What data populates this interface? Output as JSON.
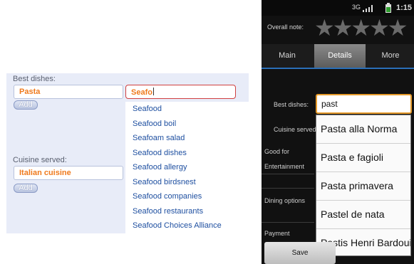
{
  "web": {
    "best_dishes_label": "Best dishes:",
    "best_dish_value": "Pasta",
    "search_value": "Seafo",
    "add_label": "Add",
    "cuisine_label": "Cuisine served:",
    "cuisine_value": "Italian cuisine",
    "suggestions": [
      "Seafood",
      "Seafood boil",
      "Seafoam salad",
      "Seafood dishes",
      "Seafood allergy",
      "Seafood birdsnest",
      "Seafood companies",
      "Seafood restaurants",
      "Seafood Choices Alliance"
    ]
  },
  "android": {
    "status": {
      "network": "3G",
      "time": "1:15"
    },
    "overall_note_label": "Overall note:",
    "rating": 0,
    "tabs": [
      {
        "label": "Main",
        "selected": false
      },
      {
        "label": "Details",
        "selected": true
      },
      {
        "label": "More",
        "selected": false
      }
    ],
    "rows": {
      "best_dishes": "Best dishes:",
      "cuisine_served": "Cuisine served",
      "good_for": "Good for",
      "entertainment": "Entertainment",
      "dining_options": "Dining options",
      "payment": "Payment"
    },
    "input_value": "past",
    "suggestions": [
      "Pasta alla Norma",
      "Pasta e fagioli",
      "Pasta primavera",
      "Pastel de nata",
      "Pastis Henri Bardouin"
    ],
    "save_label": "Save",
    "colors": {
      "focus": "#e69a2a",
      "tab_indicator": "#2a6fb8",
      "link": "#1e4fa0",
      "accent_text": "#ef7a1d"
    }
  }
}
